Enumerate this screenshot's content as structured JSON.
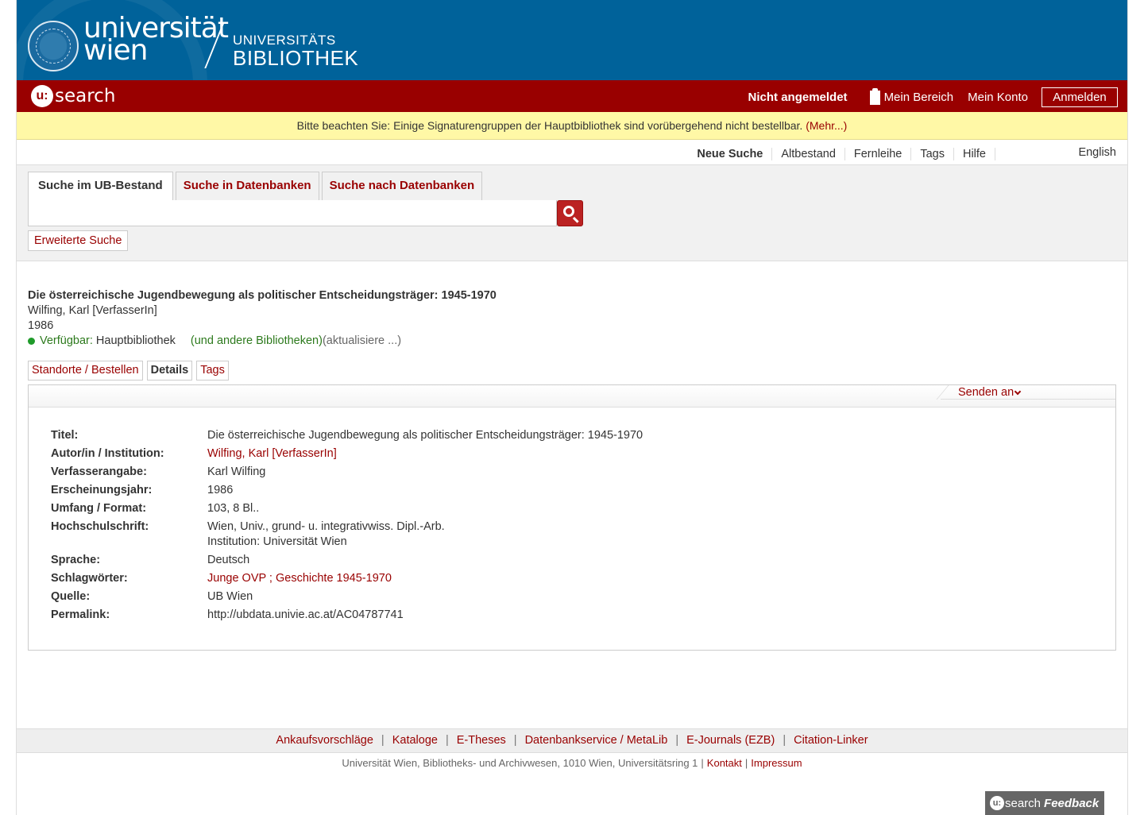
{
  "header": {
    "logo_line1": "universität",
    "logo_line2": "wien",
    "ub_line1": "UNIVERSITÄTS",
    "ub_line2": "BIBLIOTHEK"
  },
  "redbar": {
    "brand_u": "u:",
    "brand_text": "search",
    "status": "Nicht angemeldet",
    "mein_bereich": "Mein Bereich",
    "mein_konto": "Mein Konto",
    "login": "Anmelden"
  },
  "notice": {
    "text": "Bitte beachten Sie: Einige Signaturengruppen der Hauptbibliothek sind vorübergehend nicht bestellbar. ",
    "link": "(Mehr...)"
  },
  "topnav": {
    "items": [
      "Neue Suche",
      "Altbestand",
      "Fernleihe",
      "Tags",
      "Hilfe"
    ],
    "lang": "English"
  },
  "search": {
    "tabs": [
      "Suche im UB-Bestand",
      "Suche in Datenbanken",
      "Suche nach Datenbanken"
    ],
    "query": "",
    "advanced": "Erweiterte Suche"
  },
  "record": {
    "title": "Die österreichische Jugendbewegung als politischer Entscheidungsträger: 1945-1970",
    "author": "Wilfing, Karl [VerfasserIn]",
    "year": "1986",
    "avail_label": "Verfügbar:",
    "avail_lib": "Hauptbibliothek",
    "other_libs": "(und andere Bibliotheken)",
    "refresh": "(aktualisiere ...)"
  },
  "subtabs": [
    "Standorte / Bestellen",
    "Details",
    "Tags"
  ],
  "senden": "Senden an",
  "details": {
    "rows": [
      {
        "label": "Titel:",
        "value": "Die österreichische Jugendbewegung als politischer Entscheidungsträger: 1945-1970",
        "link": false
      },
      {
        "label": "Autor/in / Institution:",
        "value": "Wilfing, Karl [VerfasserIn]",
        "link": true
      },
      {
        "label": "Verfasserangabe:",
        "value": "Karl Wilfing",
        "link": false
      },
      {
        "label": "Erscheinungsjahr:",
        "value": "1986",
        "link": false
      },
      {
        "label": "Umfang / Format:",
        "value": "103, 8 Bl..",
        "link": false
      },
      {
        "label": "Hochschulschrift:",
        "value": "Wien, Univ., grund- u. integrativwiss. Dipl.-Arb.",
        "value2": "Institution: Universität Wien",
        "link": false
      },
      {
        "label": "Sprache:",
        "value": "Deutsch",
        "link": false
      },
      {
        "label": "Schlagwörter:",
        "value": "Junge OVP ; Geschichte 1945-1970",
        "link": true
      },
      {
        "label": "Quelle:",
        "value": "UB Wien",
        "link": false
      },
      {
        "label": "Permalink:",
        "value": "http://ubdata.univie.ac.at/AC04787741",
        "link": false
      }
    ]
  },
  "footer": {
    "links": [
      "Ankaufsvorschläge",
      "Kataloge",
      "E-Theses",
      "Datenbankservice / MetaLib",
      "E-Journals (EZB)",
      "Citation-Linker"
    ],
    "address": "Universität Wien, Bibliotheks- und Archivwesen, 1010 Wien, Universitätsring 1",
    "kontakt": "Kontakt",
    "impressum": "Impressum",
    "separator": "|"
  },
  "feedback": {
    "u": "u:",
    "search": "search",
    "label": "Feedback"
  },
  "colors": {
    "header_blue": "#00629a",
    "brand_red": "#990000",
    "notice_yellow": "#fff8a6",
    "available_green": "#1f9b2a"
  }
}
